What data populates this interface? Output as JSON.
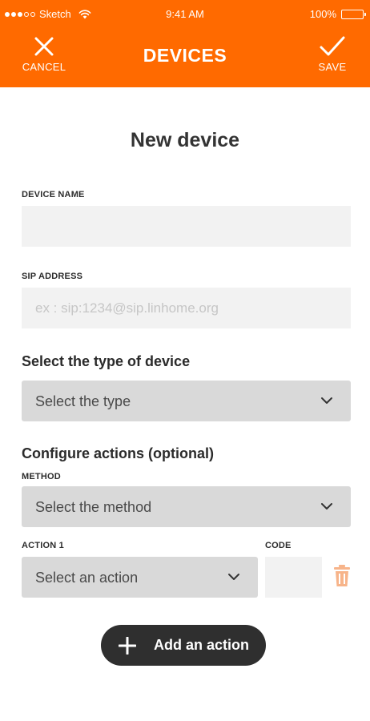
{
  "status_bar": {
    "carrier": "Sketch",
    "time": "9:41 AM",
    "battery": "100%",
    "battery_level": 1.0
  },
  "header": {
    "title": "DEVICES",
    "cancel_label": "CANCEL",
    "save_label": "SAVE",
    "background_color": "#ff6a00"
  },
  "form": {
    "title": "New device",
    "device_name": {
      "label": "DEVICE NAME",
      "value": "",
      "placeholder": ""
    },
    "sip_address": {
      "label": "SIP ADDRESS",
      "value": "",
      "placeholder": "ex : sip:1234@sip.linhome.org"
    },
    "device_type": {
      "heading": "Select the type of device",
      "selected": "Select the type"
    },
    "actions": {
      "heading": "Configure actions (optional)",
      "method_label": "METHOD",
      "method_selected": "Select the method",
      "action_label": "ACTION 1",
      "action_selected": "Select an action",
      "code_label": "CODE",
      "code_value": ""
    },
    "add_action_label": "Add an action"
  },
  "icons": {
    "cancel": "close-icon",
    "save": "checkmark-icon",
    "dropdown": "chevron-down-icon",
    "delete": "trash-icon",
    "add": "plus-icon",
    "wifi": "wifi-icon",
    "battery": "battery-icon"
  },
  "colors": {
    "accent": "#ff6a00",
    "trash": "#f7b48a",
    "button_dark": "#2f2f2f"
  }
}
